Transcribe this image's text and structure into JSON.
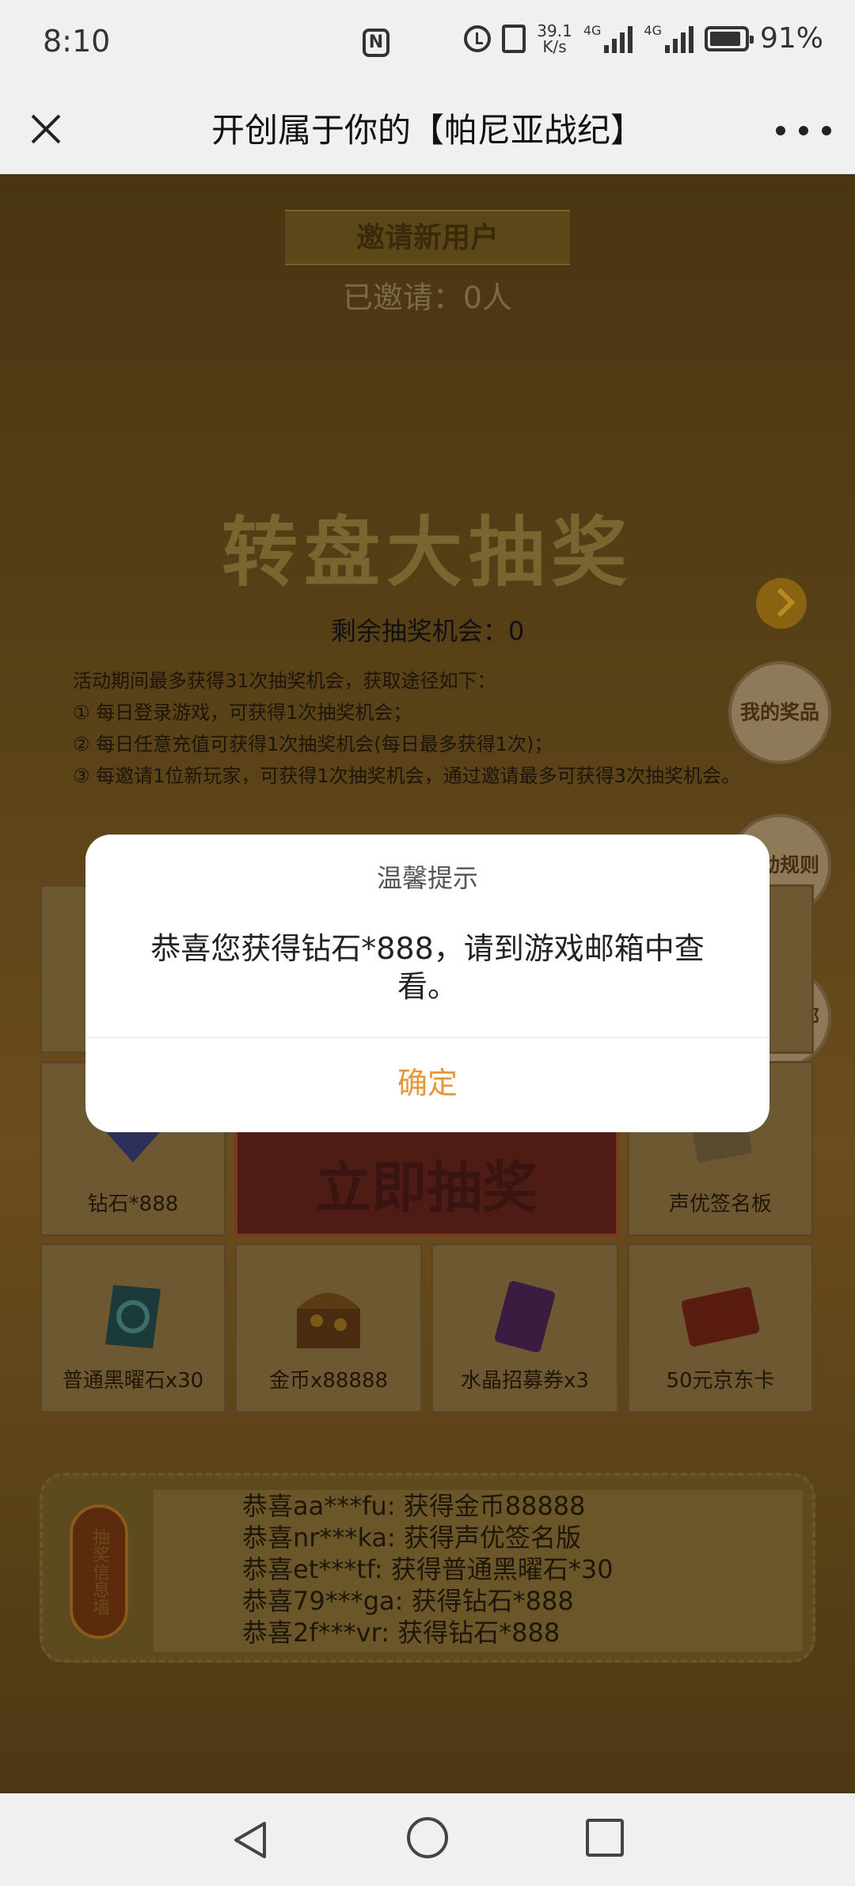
{
  "status_bar": {
    "time": "8:10",
    "nfc": "N",
    "net_speed_value": "39.1",
    "net_speed_unit": "K/s",
    "sim1_label": "4G",
    "sim2_label": "4G",
    "battery": "91%",
    "battery_level": 0.91
  },
  "title_bar": {
    "title": "开创属于你的【帕尼亚战纪】"
  },
  "page": {
    "invite_banner": "邀请新用户",
    "invited_count": "已邀请：0人",
    "wheel_title": "转盘大抽奖",
    "remaining": "剩余抽奖机会：0",
    "rules": [
      "活动期间最多获得31次抽奖机会，获取途径如下：",
      "① 每日登录游戏，可获得1次抽奖机会；",
      "② 每日任意充值可获得1次抽奖机会(每日最多获得1次)；",
      "③ 每邀请1位新玩家，可获得1次抽奖机会，通过邀请最多可获得3次抽奖机会。"
    ],
    "side_buttons": {
      "my_prizes": "我的奖品",
      "rules": "活动规则",
      "back_top": "返回顶部"
    },
    "center_button": "立即抽奖",
    "prizes": [
      {
        "label": "钻石*888",
        "icon": "diamond-icon"
      },
      {
        "label": "声优签名板",
        "icon": "signboard-icon"
      },
      {
        "label": "普通黑曜石x30",
        "icon": "obsidian-icon"
      },
      {
        "label": "金币x88888",
        "icon": "treasure-chest-icon"
      },
      {
        "label": "水晶招募券x3",
        "icon": "crystal-ticket-icon"
      },
      {
        "label": "50元京东卡",
        "icon": "jd-card-icon"
      }
    ],
    "ticker_tag": "抽奖信息墙",
    "ticker": [
      "恭喜aa***fu:    获得金币88888",
      "恭喜nr***ka:    获得声优签名版",
      "恭喜et***tf:    获得普通黑曜石*30",
      "恭喜79***ga:    获得钻石*888",
      "恭喜2f***vr:    获得钻石*888"
    ]
  },
  "dialog": {
    "title": "温馨提示",
    "message": "恭喜您获得钻石*888，请到游戏邮箱中查看。",
    "ok": "确定"
  },
  "colors": {
    "accent_ok": "#e8963a",
    "overlay_bg": "#4a3512"
  }
}
